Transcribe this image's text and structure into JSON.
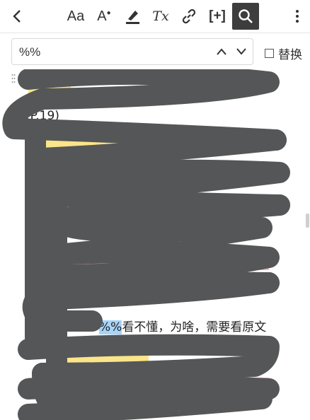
{
  "toolbar": {
    "back_icon": "chevron-left-icon",
    "font_label": "Aa",
    "color_label": "A",
    "eraser_label": "Tx",
    "insert_label": "[+]",
    "more_icon": "vertical-dots-icon"
  },
  "search": {
    "value": "%%",
    "replace_label": "替换"
  },
  "document": {
    "visible_fragments": [
      "(P.19)",
      "%%",
      "看不懂，为啥，需要看原文"
    ],
    "match_text": "%%",
    "after_match_text": "看不懂，为啥，需要看原文"
  },
  "colors": {
    "scribble": "#555657",
    "highlight_yellow": "#fbe58a",
    "highlight_red": "#f5b8b8",
    "match_highlight": "#a8d4f7",
    "active_tool_bg": "#3d3d3d"
  }
}
